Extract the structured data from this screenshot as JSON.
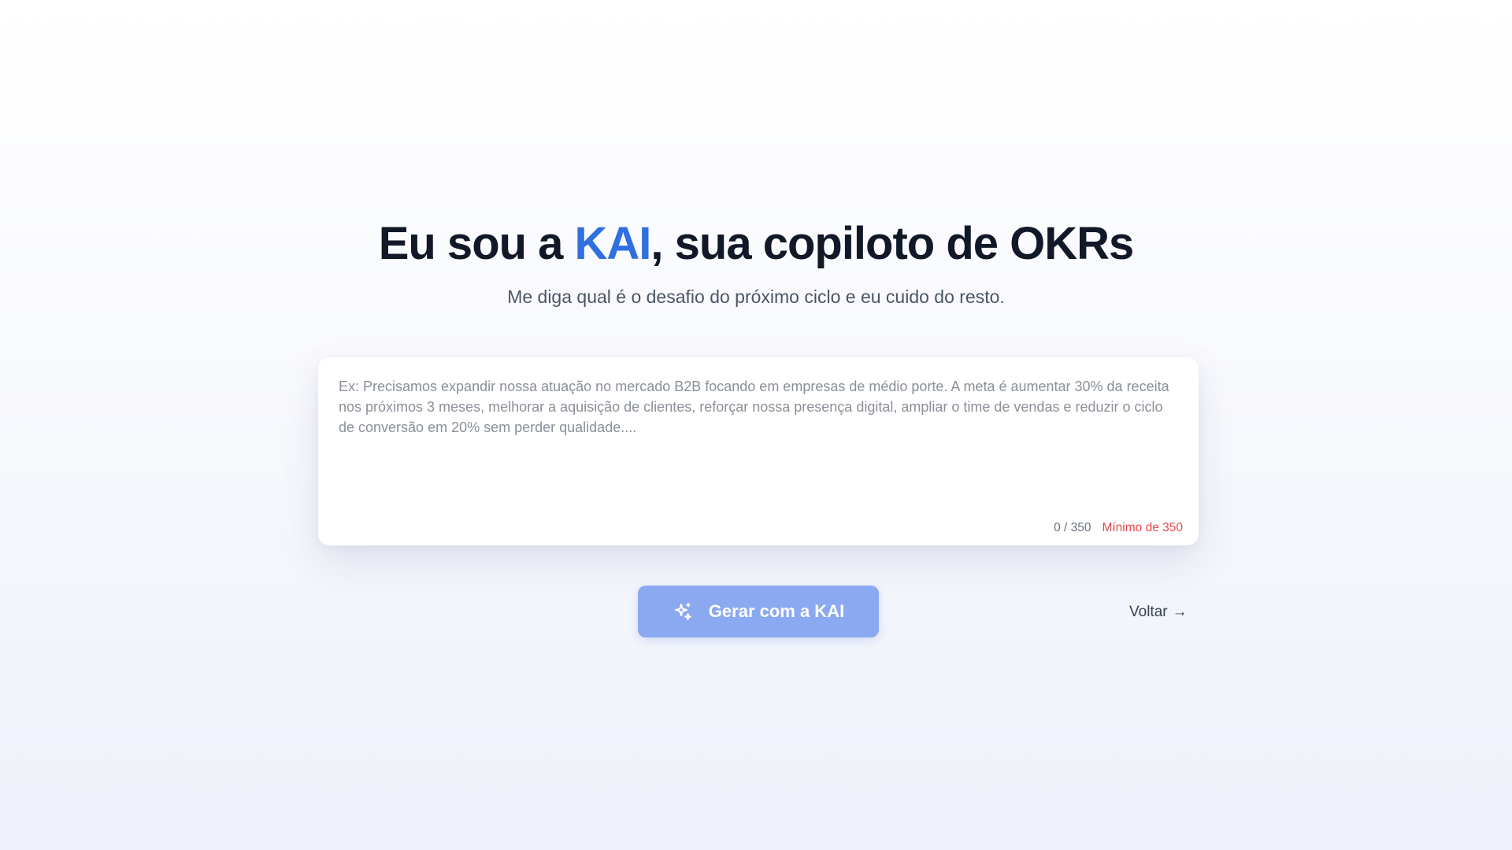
{
  "hero": {
    "title_before": "Eu sou a ",
    "title_accent": "KAI",
    "title_after": ", sua copiloto de OKRs",
    "subtitle": "Me diga qual é o desafio do próximo ciclo e eu cuido do resto."
  },
  "prompt": {
    "value": "",
    "placeholder": "Ex: Precisamos expandir nossa atuação no mercado B2B focando em empresas de médio porte. A meta é aumentar 30% da receita nos próximos 3 meses, melhorar a aquisição de clientes, reforçar nossa presença digital, ampliar o time de vendas e reduzir o ciclo de conversão em 20% sem perder qualidade....",
    "counter": "0 / 350",
    "minimum_label": "Mínimo de 350"
  },
  "actions": {
    "generate_label": "Gerar com a KAI",
    "generate_icon": "sparkles-icon",
    "back_label": "Voltar",
    "back_arrow": "→"
  },
  "colors": {
    "accent": "#2f6fe0",
    "button_disabled": "#8ba9f0",
    "warning": "#e5484d"
  }
}
